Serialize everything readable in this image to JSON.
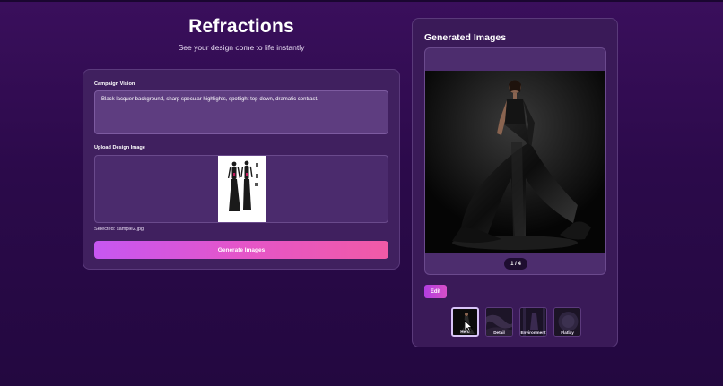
{
  "app": {
    "title": "Refractions",
    "subtitle": "See your design come to life instantly"
  },
  "form": {
    "vision_label": "Campaign Vision",
    "vision_text": "Black lacquer background, sharp specular highlights, spotlight top-down, dramatic contrast.",
    "upload_label": "Upload Design Image",
    "selected_text": "Selected: sample2.jpg",
    "generate_label": "Generate Images"
  },
  "results": {
    "title": "Generated Images",
    "counter": "1 / 4",
    "edit_label": "Edit",
    "thumbnails": [
      {
        "label": "Hero",
        "active": true
      },
      {
        "label": "Detail",
        "active": false
      },
      {
        "label": "Environment",
        "active": false
      },
      {
        "label": "Flatlay",
        "active": false
      }
    ]
  },
  "colors": {
    "accent_start": "#c657f2",
    "accent_end": "#f15aa6",
    "background": "#2b0a4a"
  }
}
